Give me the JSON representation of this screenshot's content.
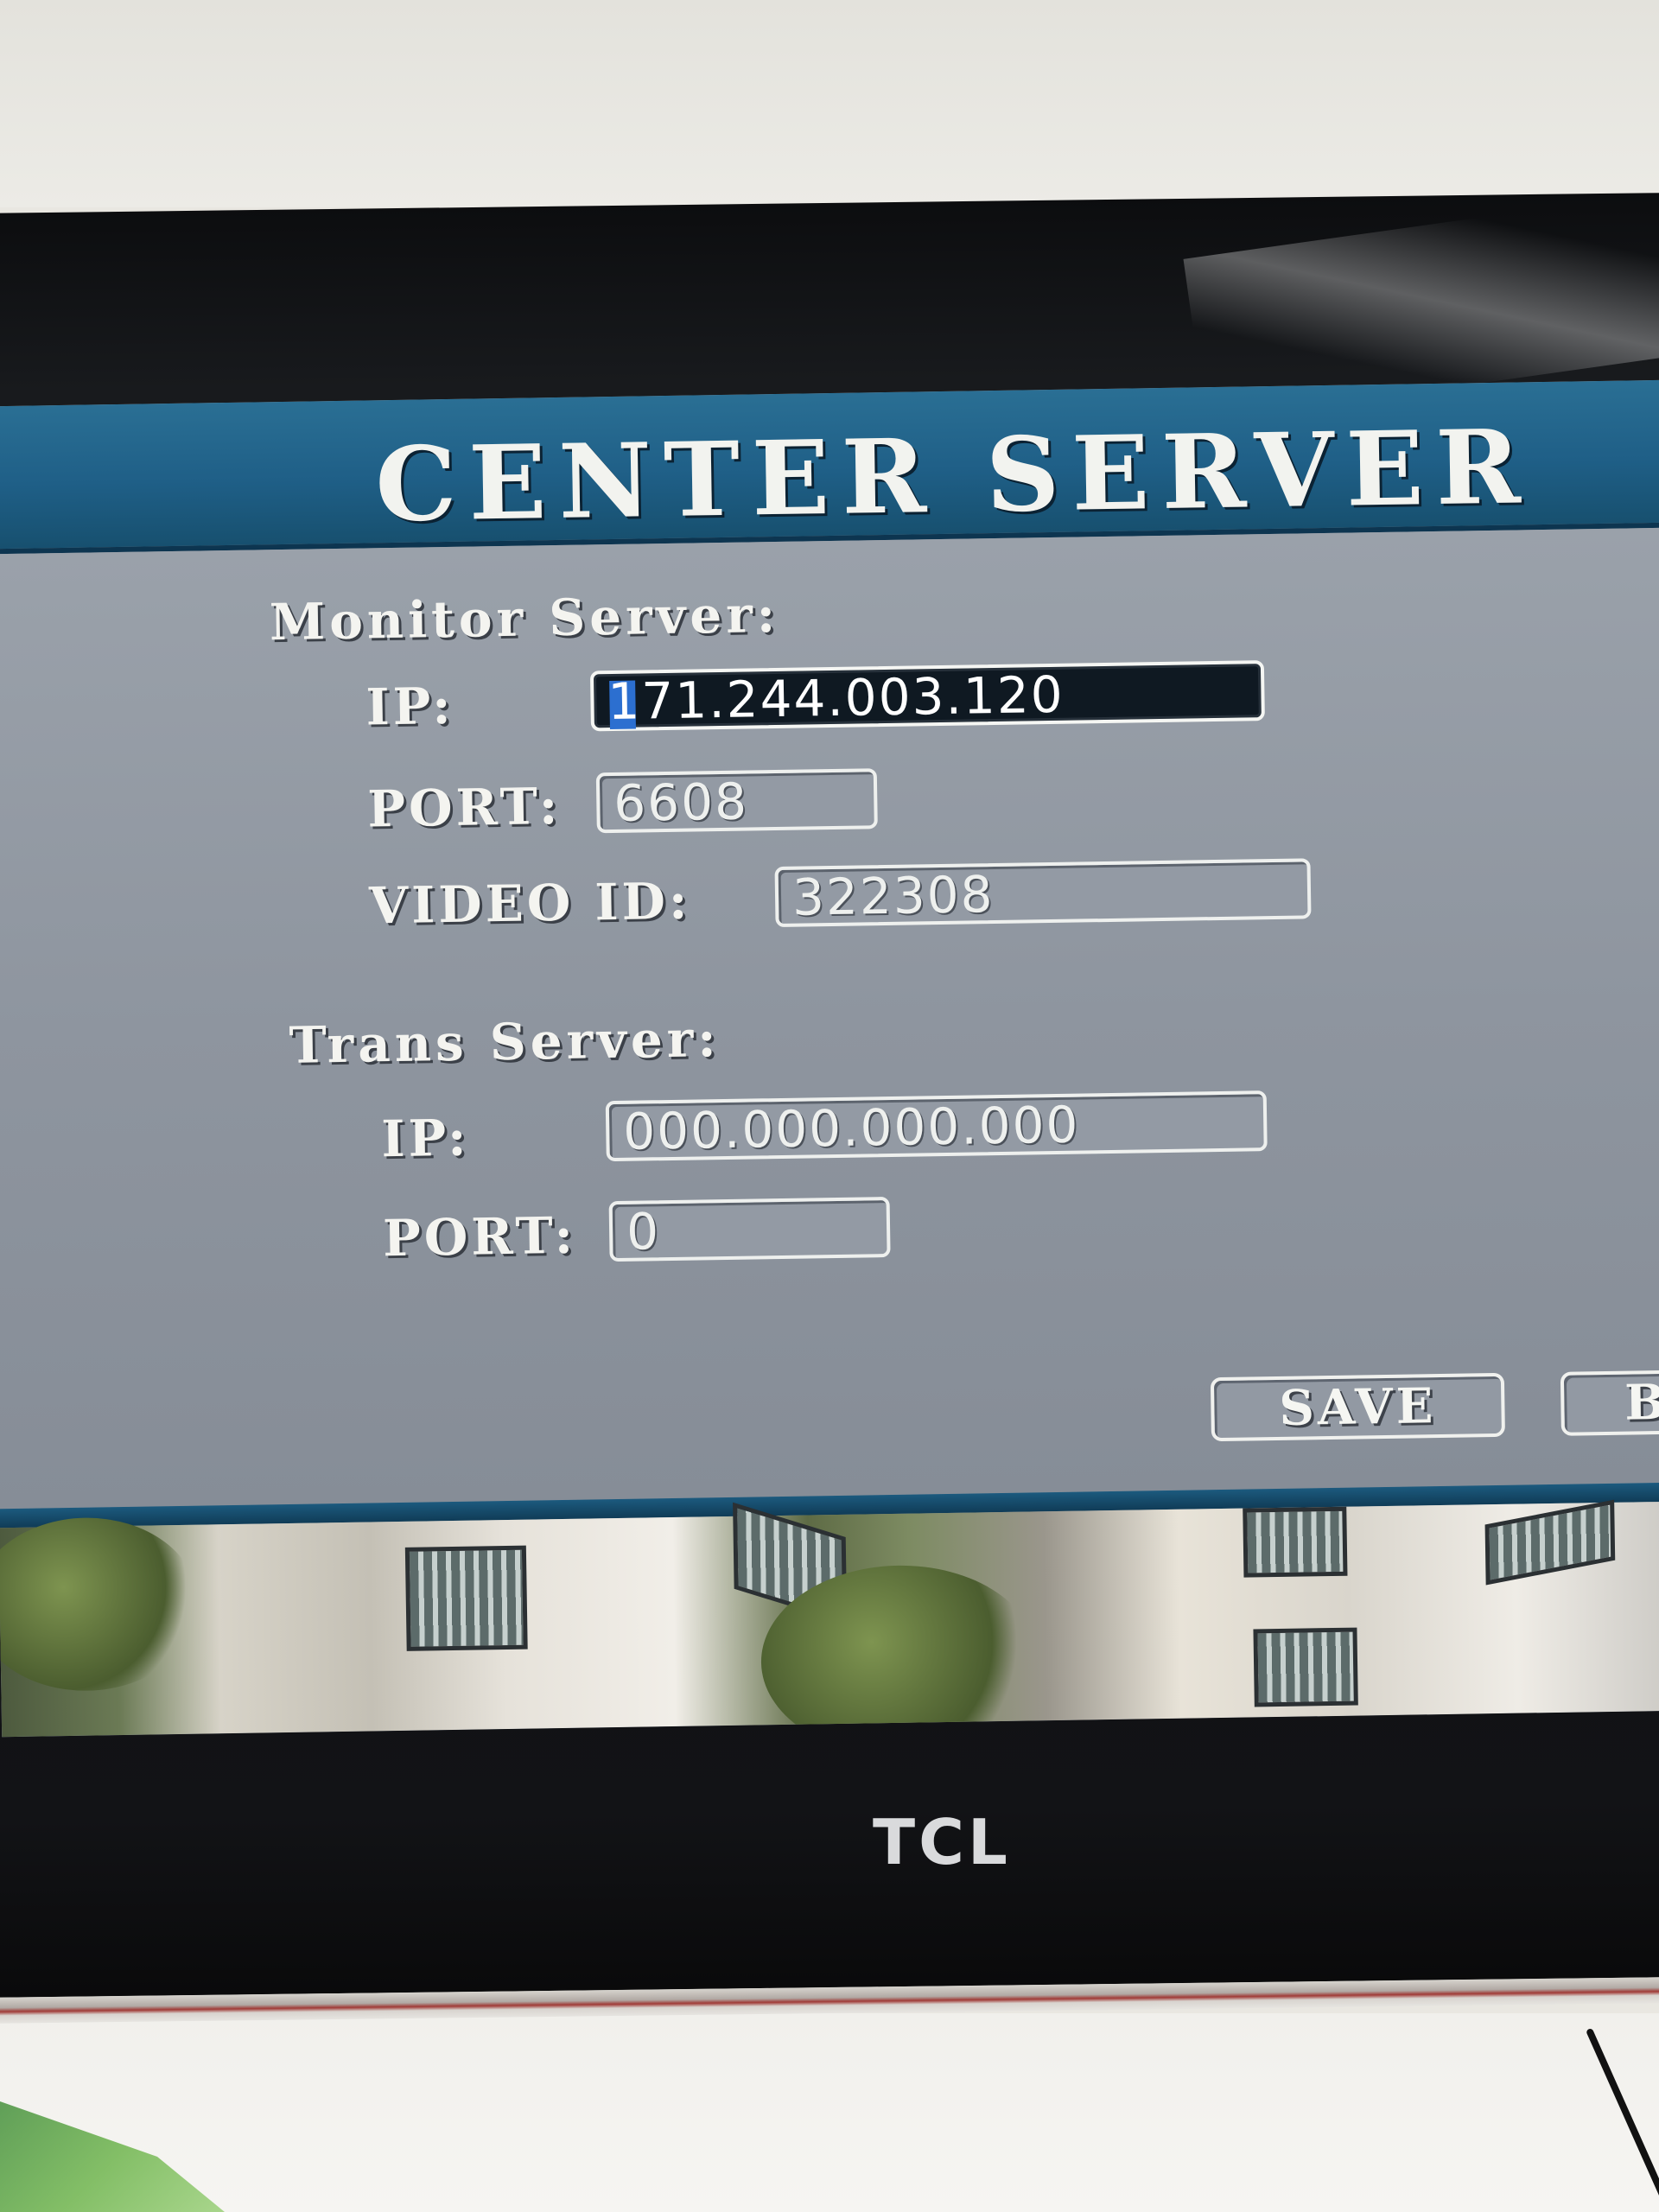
{
  "screen": {
    "title": "CENTER SERVER",
    "monitor_server": {
      "label": "Monitor Server:",
      "ip_label": "IP:",
      "ip_value": "171.244.003.120",
      "port_label": "PORT:",
      "port_value": "6608",
      "video_id_label": "VIDEO ID:",
      "video_id_value": "322308"
    },
    "trans_server": {
      "label": "Trans Server:",
      "ip_label": "IP:",
      "ip_value": "000.000.000.000",
      "port_label": "PORT:",
      "port_value": "0"
    },
    "buttons": {
      "save_label": "SAVE",
      "back_label": "B"
    }
  },
  "tv": {
    "brand": "TCL"
  },
  "colors": {
    "header": "#1f5f87",
    "panel": "#8f96a0",
    "active_field": "#0f1922",
    "cursor": "#2c6fd0"
  }
}
